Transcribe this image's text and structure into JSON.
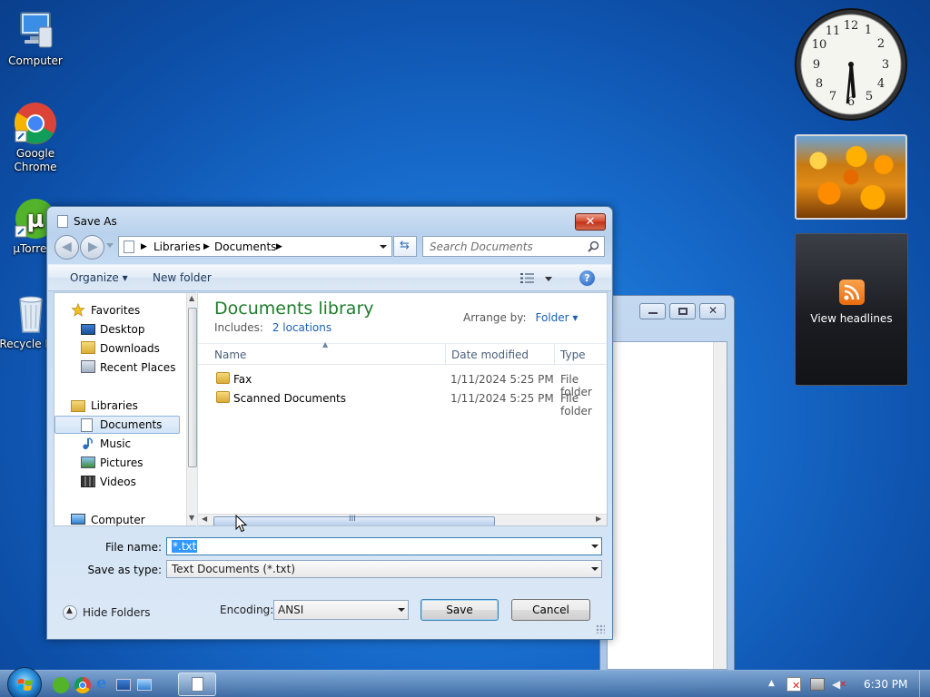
{
  "desktop": {
    "icons": [
      {
        "label": "Computer"
      },
      {
        "label": "Google Chrome"
      },
      {
        "label": "µTorrent"
      },
      {
        "label": "Recycle Bin"
      }
    ]
  },
  "gadgets": {
    "clock_numbers": [
      "12",
      "1",
      "2",
      "3",
      "4",
      "5",
      "6",
      "7",
      "8",
      "9",
      "10",
      "11"
    ],
    "feed_label": "View headlines"
  },
  "dialog": {
    "title": "Save As",
    "close_label": "✕",
    "address": {
      "crumbs": [
        "Libraries",
        "Documents"
      ]
    },
    "search_placeholder": "Search Documents",
    "toolbar": {
      "organize": "Organize ▾",
      "new_folder": "New folder",
      "help": "?"
    },
    "nav": {
      "favorites": "Favorites",
      "desktop": "Desktop",
      "downloads": "Downloads",
      "recent": "Recent Places",
      "libraries": "Libraries",
      "documents": "Documents",
      "music": "Music",
      "pictures": "Pictures",
      "videos": "Videos",
      "computer": "Computer"
    },
    "library": {
      "title": "Documents library",
      "includes_label": "Includes:",
      "includes_link": "2 locations",
      "arrange_label": "Arrange by:",
      "arrange_value": "Folder ▾"
    },
    "columns": {
      "name": "Name",
      "date": "Date modified",
      "type": "Type"
    },
    "files": [
      {
        "name": "Fax",
        "date": "1/11/2024 5:25 PM",
        "type": "File folder"
      },
      {
        "name": "Scanned Documents",
        "date": "1/11/2024 5:25 PM",
        "type": "File folder"
      }
    ],
    "filename_label": "File name:",
    "filename_value": "*.txt",
    "savetype_label": "Save as type:",
    "savetype_value": "Text Documents (*.txt)",
    "hide_folders": "Hide Folders",
    "encoding_label": "Encoding:",
    "encoding_value": "ANSI",
    "save_button": "Save",
    "cancel_button": "Cancel"
  },
  "taskbar": {
    "time": "6:30 PM"
  },
  "colors": {
    "library_title": "#1e7e2c",
    "link": "#1a5fb4",
    "close": "#c03018"
  }
}
